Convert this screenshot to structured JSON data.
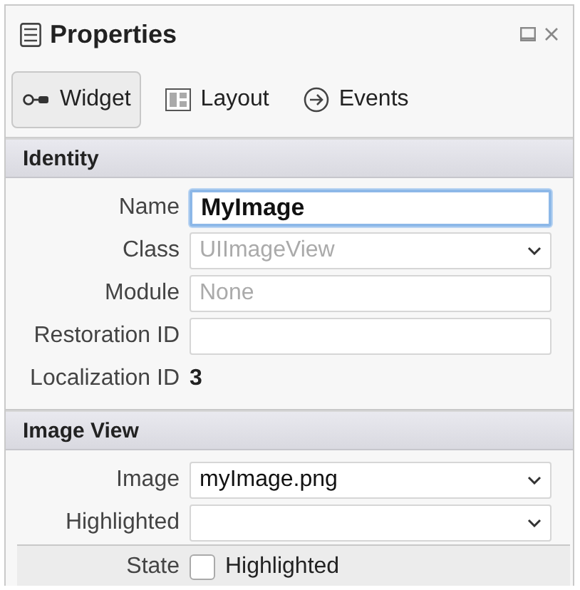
{
  "panel": {
    "title": "Properties"
  },
  "tabs": [
    {
      "label": "Widget",
      "kind": "widget",
      "selected": true
    },
    {
      "label": "Layout",
      "kind": "layout",
      "selected": false
    },
    {
      "label": "Events",
      "kind": "events",
      "selected": false
    }
  ],
  "sections": [
    {
      "title": "Identity",
      "rows": [
        {
          "label": "Name",
          "kind": "field",
          "value": "MyImage",
          "focused": true
        },
        {
          "label": "Class",
          "kind": "combo",
          "placeholder": "UIImageView"
        },
        {
          "label": "Module",
          "kind": "field",
          "placeholder": "None",
          "focused": false
        },
        {
          "label": "Restoration ID",
          "kind": "field",
          "focused": false
        },
        {
          "label": "Localization ID",
          "kind": "value",
          "value": "3"
        }
      ]
    },
    {
      "title": "Image View",
      "rows": [
        {
          "label": "Image",
          "kind": "combo",
          "value": "myImage.png"
        },
        {
          "label": "Highlighted",
          "kind": "combo"
        },
        {
          "label": "State",
          "kind": "checkbox",
          "option": "Highlighted",
          "checked": false
        }
      ]
    }
  ]
}
